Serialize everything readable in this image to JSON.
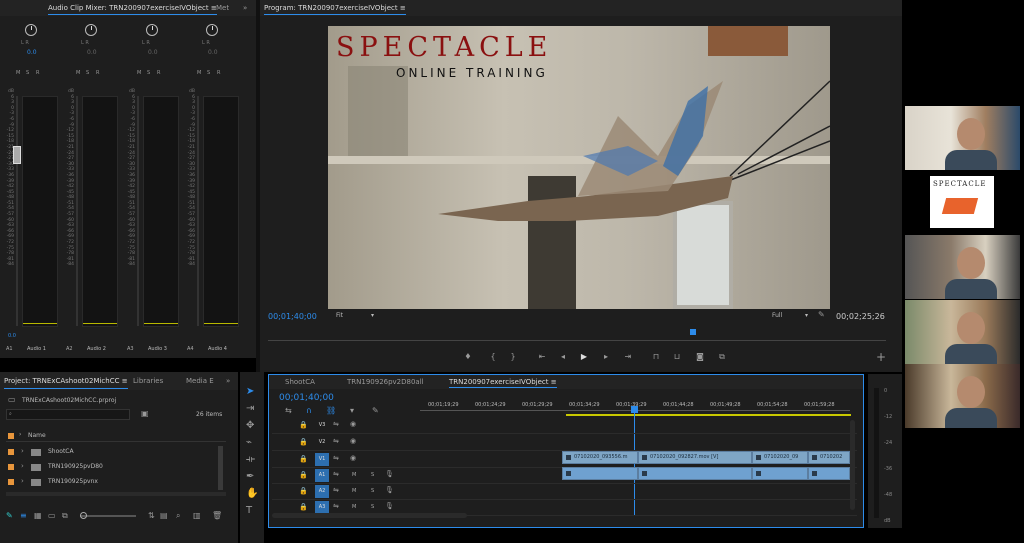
{
  "audio_mixer": {
    "tab_title": "Audio Clip Mixer: TRN200907exerciseIVObject",
    "tab_next": "Met",
    "overflow": "»",
    "channels": [
      {
        "lr": "L  R",
        "value": "0.0",
        "track": "A1",
        "name": "Audio 1"
      },
      {
        "lr": "L  R",
        "value": "0.0",
        "track": "A2",
        "name": "Audio 2"
      },
      {
        "lr": "L  R",
        "value": "0.0",
        "track": "A3",
        "name": "Audio 3"
      },
      {
        "lr": "L  R",
        "value": "0.0",
        "track": "A4",
        "name": "Audio 4"
      }
    ],
    "msr": [
      "M",
      "S",
      "R"
    ],
    "scale": [
      "dB",
      "6",
      "3",
      "0",
      "-3",
      "-6",
      "-9",
      "-12",
      "-15",
      "-18",
      "-21",
      "-24",
      "-27",
      "-30",
      "-33",
      "-36",
      "-39",
      "-42",
      "-45",
      "-48",
      "-51",
      "-54",
      "-57",
      "-60",
      "-63",
      "-66",
      "-69",
      "-72",
      "-75",
      "-78",
      "-81",
      "-84"
    ],
    "bottom_value": "0.0"
  },
  "program": {
    "tab_title": "Program: TRN200907exerciseIVObject",
    "tab_menu": "≡",
    "timecode": "00;01;40;00",
    "fit": "Fit",
    "quality": "Full",
    "duration": "00;02;25;26",
    "overlay_title": "SPECTACLE",
    "overlay_sub": "ONLINE TRAINING",
    "add": "+"
  },
  "project": {
    "tab_title": "Project: TRNExCAshoot02MichCC",
    "tab_libraries": "Libraries",
    "tab_media": "Media E",
    "overflow": "»",
    "file": "TRNExCAshoot02MichCC.prproj",
    "item_count": "26 items",
    "column_name": "Name",
    "items": [
      "ShootCA",
      "TRN190925pvD80",
      "TRN190925pvnx"
    ],
    "colors": {
      "bin": "#e8963c"
    }
  },
  "timeline": {
    "tabs": [
      "ShootCA",
      "TRN190926pv2D80all",
      "TRN200907exerciseIVObject"
    ],
    "timecode": "00;01;40;00",
    "ruler": [
      "00;01;19;29",
      "00;01;24;29",
      "00;01;29;29",
      "00;01;34;29",
      "00;01;39;29",
      "00;01;44;28",
      "00;01;49;28",
      "00;01;54;28",
      "00;01;59;28"
    ],
    "video_tracks": [
      "V3",
      "V2",
      "V1"
    ],
    "audio_tracks": [
      "A1",
      "A2",
      "A3"
    ],
    "clips": [
      {
        "label": "07102020_093556.m"
      },
      {
        "label": "07102020_092827.mov [V]"
      },
      {
        "label": "07102020_09"
      },
      {
        "label": "0710202"
      }
    ],
    "meter_scale": [
      "0",
      "-12",
      "-24",
      "-36",
      "-48",
      "dB"
    ],
    "accent": "#2d8ceb"
  },
  "webcams": [
    {
      "name": "participant-1"
    },
    {
      "name": "participant-2-logo",
      "logo": "SPECTACLE"
    },
    {
      "name": "participant-3"
    },
    {
      "name": "participant-4"
    },
    {
      "name": "participant-5"
    }
  ]
}
